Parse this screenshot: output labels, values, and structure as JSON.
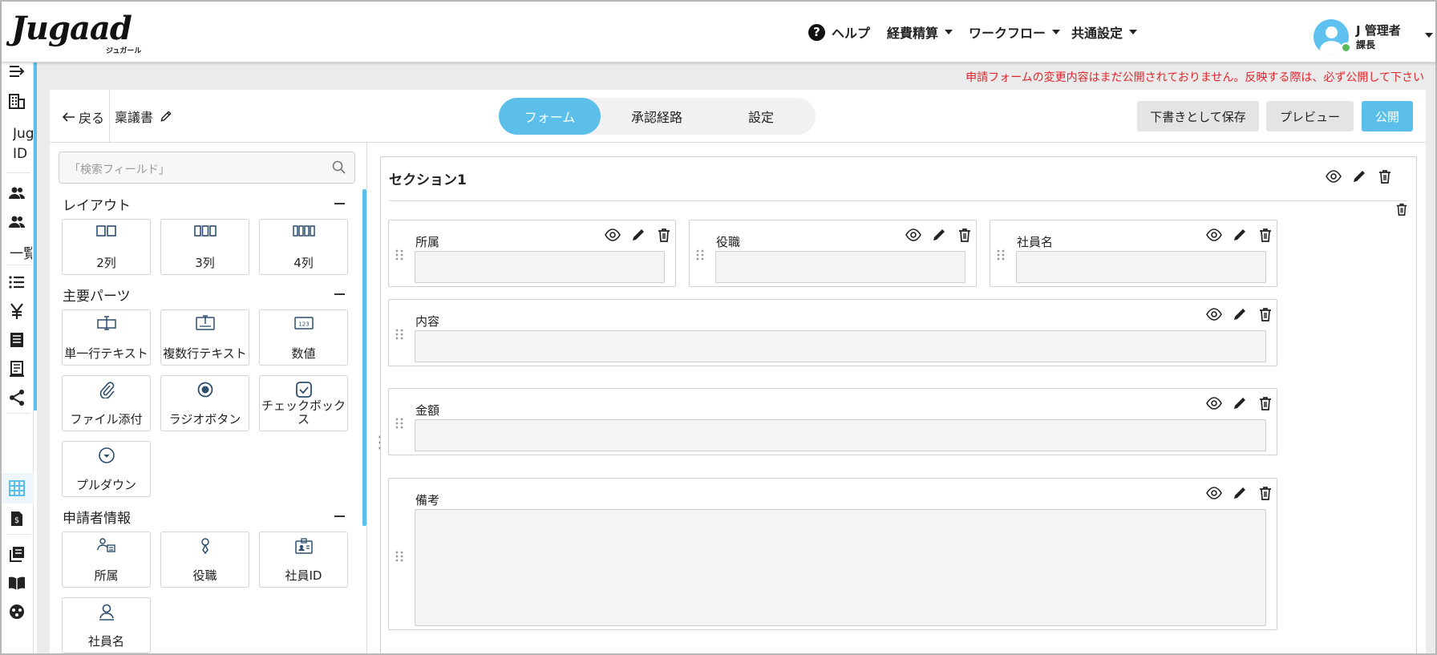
{
  "header": {
    "logo_text": "Jugaad",
    "logo_sub": "ジュガール",
    "help_label": "ヘルプ",
    "menu_expense": "経費精算",
    "menu_workflow": "ワークフロー",
    "menu_common": "共通設定",
    "user_name": "J 管理者",
    "user_role": "課長"
  },
  "sidebar": {
    "partial_text_1": "Jug",
    "partial_text_2": "ID",
    "partial_text_3": "一覧"
  },
  "notice": "申請フォームの変更内容はまだ公開されておりません。反映する際は、必ず公開して下さい",
  "toolbar": {
    "back_label": "戻る",
    "doc_title": "稟議書",
    "tabs": [
      {
        "label": "フォーム",
        "active": true
      },
      {
        "label": "承認経路",
        "active": false
      },
      {
        "label": "設定",
        "active": false
      }
    ],
    "save_draft_label": "下書きとして保存",
    "preview_label": "プレビュー",
    "publish_label": "公開"
  },
  "palette": {
    "search_placeholder": "「検索フィールド」",
    "groups": [
      {
        "title": "レイアウト",
        "items": [
          {
            "label": "2列",
            "icon": "two-column-icon"
          },
          {
            "label": "3列",
            "icon": "three-column-icon"
          },
          {
            "label": "4列",
            "icon": "four-column-icon"
          }
        ]
      },
      {
        "title": "主要パーツ",
        "items": [
          {
            "label": "単一行テキスト",
            "icon": "single-line-text-icon"
          },
          {
            "label": "複数行テキスト",
            "icon": "multi-line-text-icon"
          },
          {
            "label": "数値",
            "icon": "number-icon"
          },
          {
            "label": "ファイル添付",
            "icon": "paperclip-icon"
          },
          {
            "label": "ラジオボタン",
            "icon": "radio-icon"
          },
          {
            "label": "チェックボックス",
            "icon": "checkbox-icon"
          },
          {
            "label": "プルダウン",
            "icon": "dropdown-icon"
          }
        ]
      },
      {
        "title": "申請者情報",
        "items": [
          {
            "label": "所属",
            "icon": "department-icon"
          },
          {
            "label": "役職",
            "icon": "position-icon"
          },
          {
            "label": "社員ID",
            "icon": "employee-id-icon"
          },
          {
            "label": "社員名",
            "icon": "person-icon"
          }
        ]
      }
    ]
  },
  "form": {
    "section_title": "セクション1",
    "row1": [
      {
        "label": "所属"
      },
      {
        "label": "役職"
      },
      {
        "label": "社員名"
      }
    ],
    "fields": [
      {
        "label": "内容"
      },
      {
        "label": "金額"
      },
      {
        "label": "備考"
      }
    ]
  },
  "colors": {
    "accent": "#5bbfe9",
    "warning": "#e0262b",
    "online": "#5cb85c"
  }
}
